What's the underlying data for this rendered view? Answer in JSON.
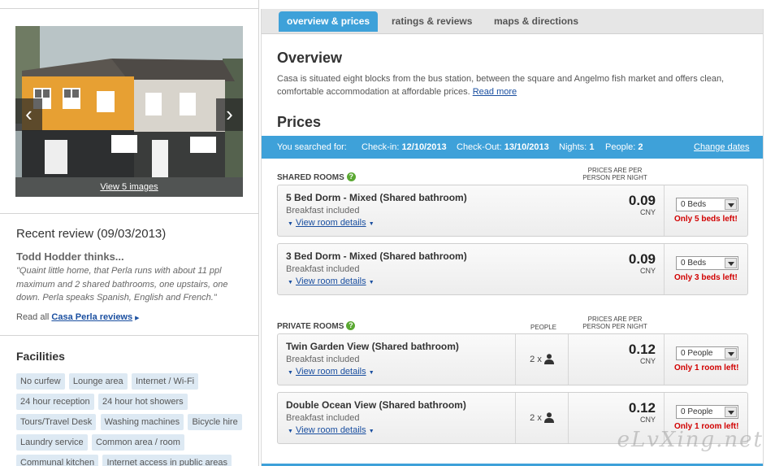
{
  "gallery": {
    "view_images_label": "View 5 images",
    "prev_arrow": "‹",
    "next_arrow": "›"
  },
  "review": {
    "heading": "Recent review (09/03/2013)",
    "author": "Todd Hodder thinks...",
    "text": "\"Quaint little home, that Perla runs with about 11 ppl maximum and 2 shared bathrooms, one upstairs, one down. Perla speaks Spanish, English and French.\"",
    "read_all_prefix": "Read all",
    "read_all_link": "Casa Perla reviews"
  },
  "facilities": {
    "heading": "Facilities",
    "items": [
      "No curfew",
      "Lounge area",
      "Internet / Wi-Fi",
      "24 hour reception",
      "24 hour hot showers",
      "Tours/Travel Desk",
      "Washing machines",
      "Bicycle hire",
      "Laundry service",
      "Common area / room",
      "Communal kitchen",
      "Internet access in public areas"
    ]
  },
  "tabs": [
    {
      "label": "overview & prices",
      "active": true
    },
    {
      "label": "ratings & reviews",
      "active": false
    },
    {
      "label": "maps & directions",
      "active": false
    }
  ],
  "overview": {
    "title": "Overview",
    "text": "Casa is situated eight blocks from the bus station, between the square and Angelmo fish market and offers clean, comfortable accommodation at affordable prices.",
    "read_more": "Read more"
  },
  "prices": {
    "title": "Prices",
    "search": {
      "label": "You searched for:",
      "checkin_label": "Check-in:",
      "checkin": "12/10/2013",
      "checkout_label": "Check-Out:",
      "checkout": "13/10/2013",
      "nights_label": "Nights:",
      "nights": "1",
      "people_label": "People:",
      "people": "2",
      "change_dates": "Change dates"
    },
    "shared": {
      "heading": "Shared Rooms",
      "price_head": "Prices are per person per night",
      "rooms": [
        {
          "name": "5 Bed Dorm - Mixed (Shared bathroom)",
          "meal": "Breakfast included",
          "details": "View room details",
          "price": "0.09",
          "currency": "CNY",
          "select": "0 Beds",
          "availability": "Only 5 beds left!"
        },
        {
          "name": "3 Bed Dorm - Mixed (Shared bathroom)",
          "meal": "Breakfast included",
          "details": "View room details",
          "price": "0.09",
          "currency": "CNY",
          "select": "0 Beds",
          "availability": "Only 3 beds left!"
        }
      ]
    },
    "private": {
      "heading": "Private Rooms",
      "people_head": "People",
      "price_head": "Prices are per person per night",
      "rooms": [
        {
          "name": "Twin Garden View (Shared bathroom)",
          "meal": "Breakfast included",
          "details": "View room details",
          "people": "2 x",
          "price": "0.12",
          "currency": "CNY",
          "select": "0 People",
          "availability": "Only 1 room left!"
        },
        {
          "name": "Double Ocean View (Shared bathroom)",
          "meal": "Breakfast included",
          "details": "View room details",
          "people": "2 x",
          "price": "0.12",
          "currency": "CNY",
          "select": "0 People",
          "availability": "Only 1 room left!"
        }
      ]
    }
  },
  "watermark": "eLvXing.net",
  "colors": {
    "accent": "#3ea1d9",
    "link": "#1a4fa0",
    "alert": "#d10000",
    "facility_tag": "#dde9f3",
    "help_icon": "#5aa832"
  }
}
